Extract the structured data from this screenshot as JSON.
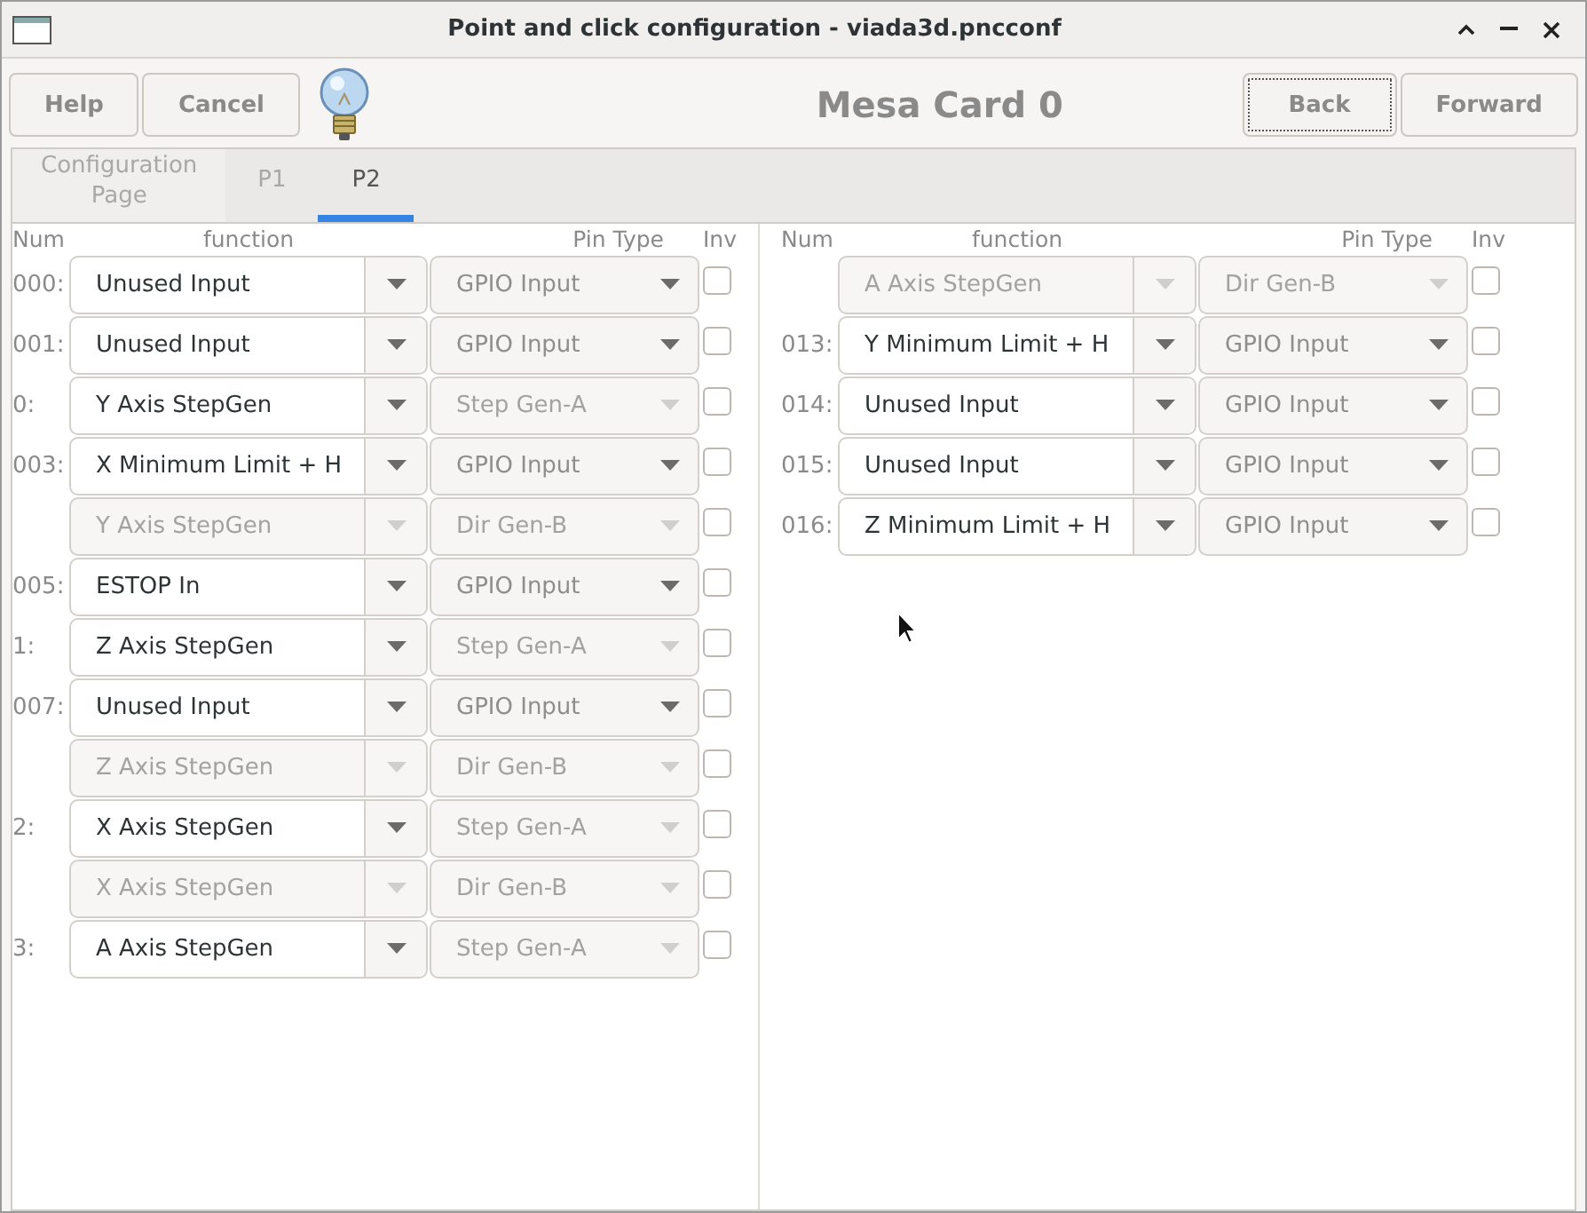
{
  "window": {
    "title": "Point and click configuration - viada3d.pncconf"
  },
  "left_buttons": [
    {
      "label": "Help"
    },
    {
      "label": "Cancel"
    }
  ],
  "card_title": "Mesa Card 0",
  "right_buttons": [
    {
      "label": "Back",
      "focused": true
    },
    {
      "label": "Forward",
      "focused": false
    }
  ],
  "tabs": [
    {
      "label": "Configuration\nPage",
      "selected": false
    },
    {
      "label": "P1",
      "selected": false
    },
    {
      "label": "P2",
      "selected": true
    }
  ],
  "panels": [
    {
      "headers": [
        "Num",
        "function",
        "Pin Type",
        "Inv"
      ],
      "rows": [
        {
          "num": "000:",
          "function": "Unused Input",
          "function_enabled": true,
          "pin_type": "GPIO Input",
          "pin_enabled": true,
          "checked": false
        },
        {
          "num": "001:",
          "function": "Unused Input",
          "function_enabled": true,
          "pin_type": "GPIO Input",
          "pin_enabled": true,
          "checked": false
        },
        {
          "num": "0:",
          "function": "Y Axis StepGen",
          "function_enabled": true,
          "pin_type": "Step Gen-A",
          "pin_enabled": false,
          "checked": false
        },
        {
          "num": "003:",
          "function": "X Minimum Limit + H",
          "function_enabled": true,
          "pin_type": "GPIO Input",
          "pin_enabled": true,
          "checked": false
        },
        {
          "function": "Y Axis StepGen",
          "function_enabled": false,
          "pin_type": "Dir Gen-B",
          "pin_enabled": false,
          "checked": false
        },
        {
          "num": "005:",
          "function": "ESTOP In",
          "function_enabled": true,
          "pin_type": "GPIO Input",
          "pin_enabled": true,
          "checked": false
        },
        {
          "num": "1:",
          "function": "Z Axis StepGen",
          "function_enabled": true,
          "pin_type": "Step Gen-A",
          "pin_enabled": false,
          "checked": false
        },
        {
          "num": "007:",
          "function": "Unused Input",
          "function_enabled": true,
          "pin_type": "GPIO Input",
          "pin_enabled": true,
          "checked": false
        },
        {
          "function": "Z Axis StepGen",
          "function_enabled": false,
          "pin_type": "Dir Gen-B",
          "pin_enabled": false,
          "checked": false
        },
        {
          "num": "2:",
          "function": "X Axis StepGen",
          "function_enabled": true,
          "pin_type": "Step Gen-A",
          "pin_enabled": false,
          "checked": false
        },
        {
          "function": "X Axis StepGen",
          "function_enabled": false,
          "pin_type": "Dir Gen-B",
          "pin_enabled": false,
          "checked": false
        },
        {
          "num": "3:",
          "function": "A Axis StepGen",
          "function_enabled": true,
          "pin_type": "Step Gen-A",
          "pin_enabled": false,
          "checked": false
        }
      ]
    },
    {
      "headers": [
        "Num",
        "function",
        "Pin Type",
        "Inv"
      ],
      "rows": [
        {
          "function": "A Axis StepGen",
          "function_enabled": false,
          "pin_type": "Dir Gen-B",
          "pin_enabled": false,
          "checked": false
        },
        {
          "num": "013:",
          "function": "Y Minimum Limit + H",
          "function_enabled": true,
          "pin_type": "GPIO Input",
          "pin_enabled": true,
          "checked": false
        },
        {
          "num": "014:",
          "function": "Unused Input",
          "function_enabled": true,
          "pin_type": "GPIO Input",
          "pin_enabled": true,
          "checked": false
        },
        {
          "num": "015:",
          "function": "Unused Input",
          "function_enabled": true,
          "pin_type": "GPIO Input",
          "pin_enabled": true,
          "checked": false
        },
        {
          "num": "016:",
          "function": "Z Minimum Limit + H",
          "function_enabled": true,
          "pin_type": "GPIO Input",
          "pin_enabled": true,
          "checked": false
        }
      ]
    }
  ]
}
